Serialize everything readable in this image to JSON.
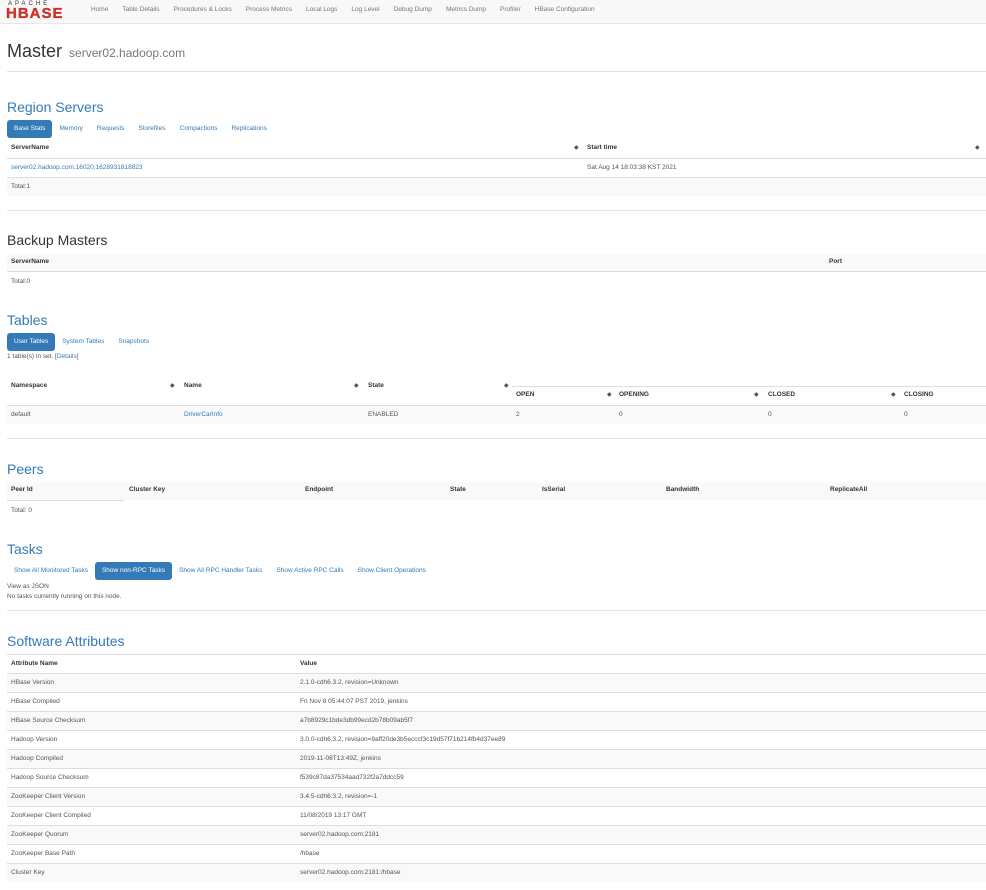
{
  "navbar": {
    "logo_top": "APACHE",
    "logo_main": "HBASE",
    "items": [
      "Home",
      "Table Details",
      "Procedures & Locks",
      "Process Metrics",
      "Local Logs",
      "Log Level",
      "Debug Dump",
      "Metrics Dump",
      "Profiler",
      "HBase Configuration"
    ]
  },
  "header": {
    "title": "Master",
    "server": "server02.hadoop.com"
  },
  "region_servers": {
    "title": "Region Servers",
    "tabs": [
      "Base Stats",
      "Memory",
      "Requests",
      "Storefiles",
      "Compactions",
      "Replications"
    ],
    "columns": [
      "ServerName",
      "Start time"
    ],
    "rows": [
      {
        "server_name": "server02.hadoop.com,16020,1628931818823",
        "start_time": "Sat Aug 14 18:03:38 KST 2021"
      }
    ],
    "total": "Total:1"
  },
  "backup_masters": {
    "title": "Backup Masters",
    "columns": [
      "ServerName",
      "Port"
    ],
    "total": "Total:0"
  },
  "tables": {
    "title": "Tables",
    "tabs": [
      "User Tables",
      "System Tables",
      "Snapshots"
    ],
    "summary_prefix": "1 table(s) in set. [",
    "details_link": "Details",
    "summary_suffix": "]",
    "columns": [
      "Namespace",
      "Name",
      "State"
    ],
    "region_columns": [
      "OPEN",
      "OPENING",
      "CLOSED",
      "CLOSING"
    ],
    "rows": [
      {
        "namespace": "default",
        "name": "DriverCarInfo",
        "state": "ENABLED",
        "open": "2",
        "opening": "0",
        "closed": "0",
        "closing": "0"
      }
    ]
  },
  "peers": {
    "title": "Peers",
    "columns": [
      "Peer Id",
      "Cluster Key",
      "Endpoint",
      "State",
      "IsSerial",
      "Bandwidth",
      "ReplicateAll"
    ],
    "total": "Total: 0"
  },
  "tasks": {
    "title": "Tasks",
    "tabs": [
      "Show All Monitored Tasks",
      "Show non-RPC Tasks",
      "Show All RPC Handler Tasks",
      "Show Active RPC Calls",
      "Show Client Operations"
    ],
    "view_json": "View as JSON",
    "empty": "No tasks currently running on this node."
  },
  "software": {
    "title": "Software Attributes",
    "columns": [
      "Attribute Name",
      "Value"
    ],
    "rows": [
      [
        "HBase Version",
        "2.1.0-cdh6.3.2, revision=Unknown"
      ],
      [
        "HBase Compiled",
        "Fri Nov 8 05:44:07 PST 2019, jenkins"
      ],
      [
        "HBase Source Checksum",
        "a7b8929c1bde3db99ecd2b78b09ab5f7"
      ],
      [
        "Hadoop Version",
        "3.0.0-cdh6.3.2, revision=9aff20de3b5ecccf3c19d57f71b214fb4d37ee89"
      ],
      [
        "Hadoop Compiled",
        "2019-11-08T13:49Z, jenkins"
      ],
      [
        "Hadoop Source Checksum",
        "f539c87da37534aad732f2a7ddcc59"
      ],
      [
        "ZooKeeper Client Version",
        "3.4.5-cdh6.3.2, revision=-1"
      ],
      [
        "ZooKeeper Client Compiled",
        "11/08/2019 13:17 GMT"
      ],
      [
        "ZooKeeper Quorum",
        "server02.hadoop.com:2181"
      ],
      [
        "ZooKeeper Base Path",
        "/hbase"
      ],
      [
        "Cluster Key",
        "server02.hadoop.com:2181:/hbase"
      ]
    ]
  }
}
